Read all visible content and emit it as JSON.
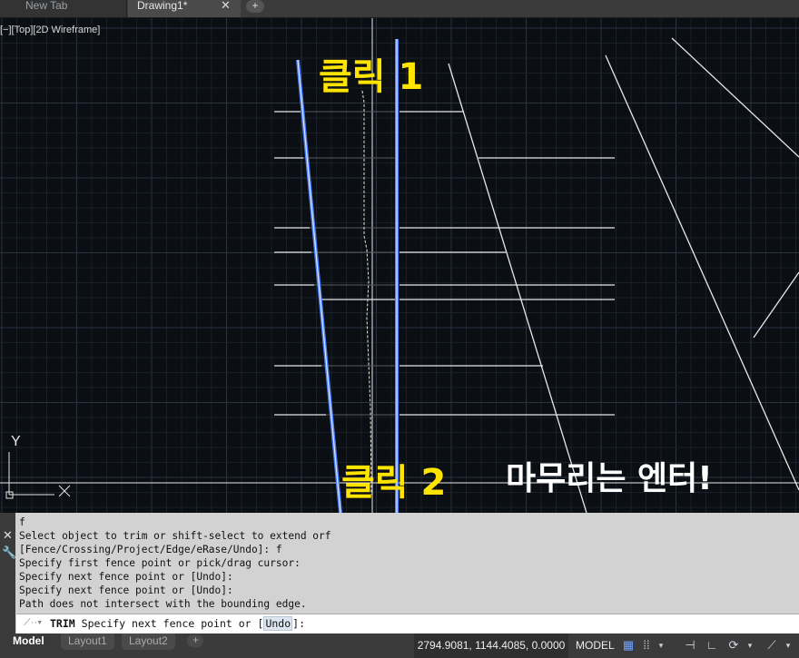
{
  "tabs": [
    {
      "label": "New Tab"
    },
    {
      "label": "Drawing1*"
    }
  ],
  "viewport": {
    "label": "[−][Top][2D Wireframe]",
    "ucs_y": "Y",
    "annotations": {
      "click1": "클릭 1",
      "click2": "클릭 2",
      "enter": "마무리는 엔터!"
    }
  },
  "command": {
    "history": [
      "f",
      "Select object to trim or shift-select to extend orf",
      "[Fence/Crossing/Project/Edge/eRase/Undo]: f",
      "Specify first fence point or pick/drag cursor:",
      "Specify next fence point or [Undo]:",
      "Specify next fence point or [Undo]:",
      "Path does not intersect with the bounding edge."
    ],
    "prompt_command": "TRIM",
    "prompt_text": "Specify next fence point or [",
    "prompt_option": "Undo",
    "prompt_end": "]:"
  },
  "status": {
    "layout_tabs": [
      "Model",
      "Layout1",
      "Layout2"
    ],
    "coordinates": "2794.9081, 1144.4085, 0.0000",
    "model_label": "MODEL"
  },
  "colors": {
    "annotation": "#ffe400",
    "selected_line": "#4a7fff",
    "background": "#0b0e13"
  }
}
